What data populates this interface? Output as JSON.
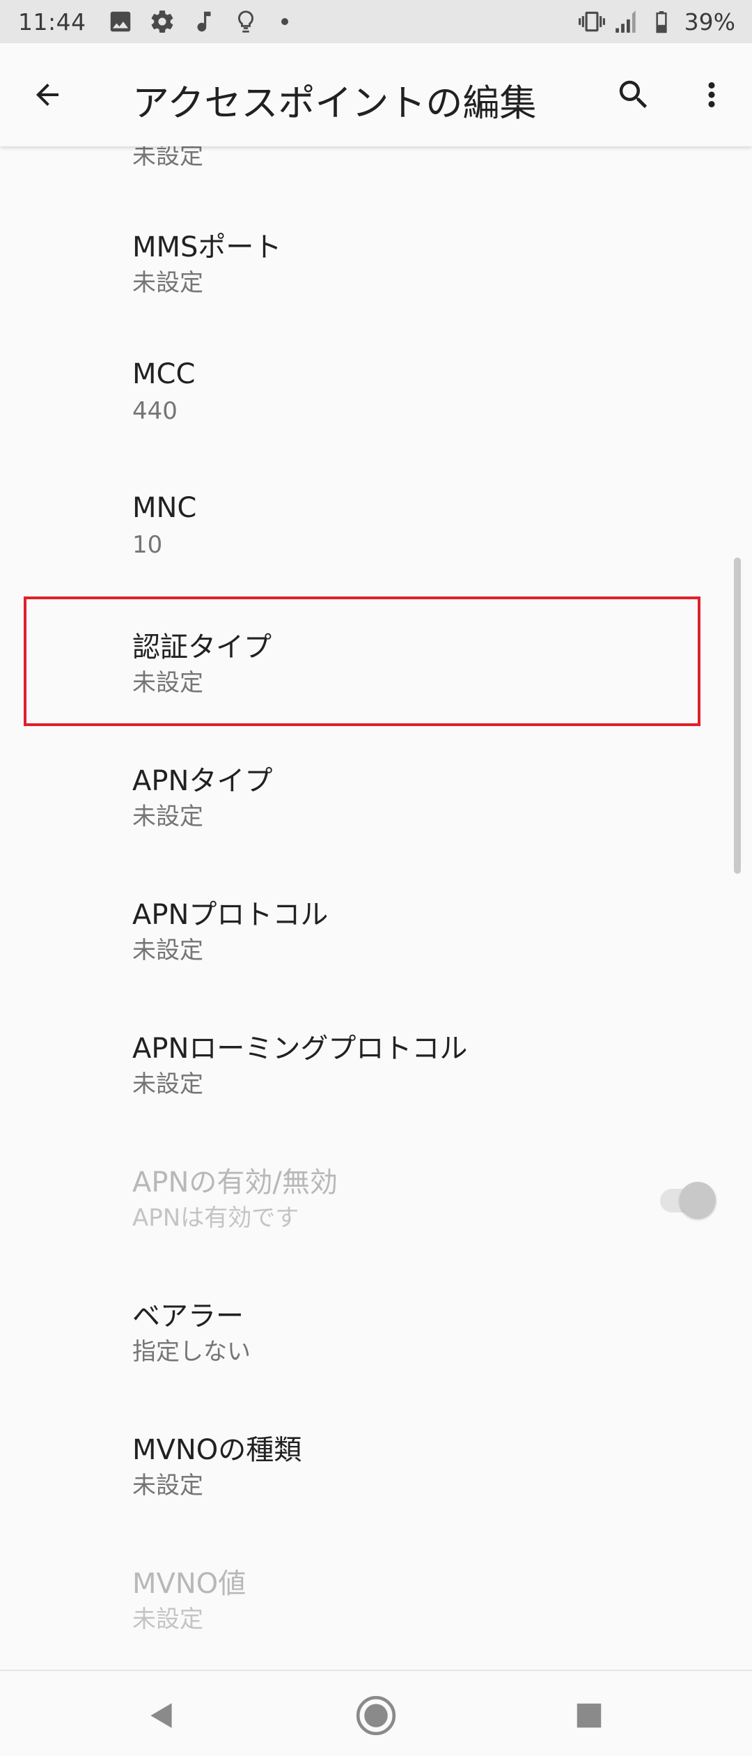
{
  "status_bar": {
    "time": "11:44",
    "left_icons": [
      "image-icon",
      "gear-icon",
      "music-note-icon",
      "lightbulb-icon",
      "dot-icon"
    ],
    "right_icons": [
      "vibrate-icon",
      "signal-icon",
      "battery-icon"
    ],
    "battery_percent": "39%"
  },
  "app_bar": {
    "title": "アクセスポイントの編集",
    "back_icon": "arrow-back-icon",
    "search_icon": "search-icon",
    "more_icon": "more-vert-icon"
  },
  "list": {
    "items": [
      {
        "title": "",
        "summary": "未設定",
        "enabled": true
      },
      {
        "title": "MMSポート",
        "summary": "未設定",
        "enabled": true
      },
      {
        "title": "MCC",
        "summary": "440",
        "enabled": true
      },
      {
        "title": "MNC",
        "summary": "10",
        "enabled": true
      },
      {
        "title": "認証タイプ",
        "summary": "未設定",
        "enabled": true,
        "highlighted": true
      },
      {
        "title": "APNタイプ",
        "summary": "未設定",
        "enabled": true
      },
      {
        "title": "APNプロトコル",
        "summary": "未設定",
        "enabled": true
      },
      {
        "title": "APNローミングプロトコル",
        "summary": "未設定",
        "enabled": true
      },
      {
        "title": "APNの有効/無効",
        "summary": "APNは有効です",
        "enabled": false,
        "toggle_on": true
      },
      {
        "title": "ベアラー",
        "summary": "指定しない",
        "enabled": true
      },
      {
        "title": "MVNOの種類",
        "summary": "未設定",
        "enabled": true
      },
      {
        "title": "MVNO値",
        "summary": "未設定",
        "enabled": false
      }
    ]
  },
  "colors": {
    "highlight_border": "#e0202a",
    "status_bar_bg": "#e6e6e6",
    "background": "#fafafa"
  },
  "nav_bar": {
    "icons": [
      "nav-back-icon",
      "nav-home-icon",
      "nav-recents-icon"
    ]
  }
}
